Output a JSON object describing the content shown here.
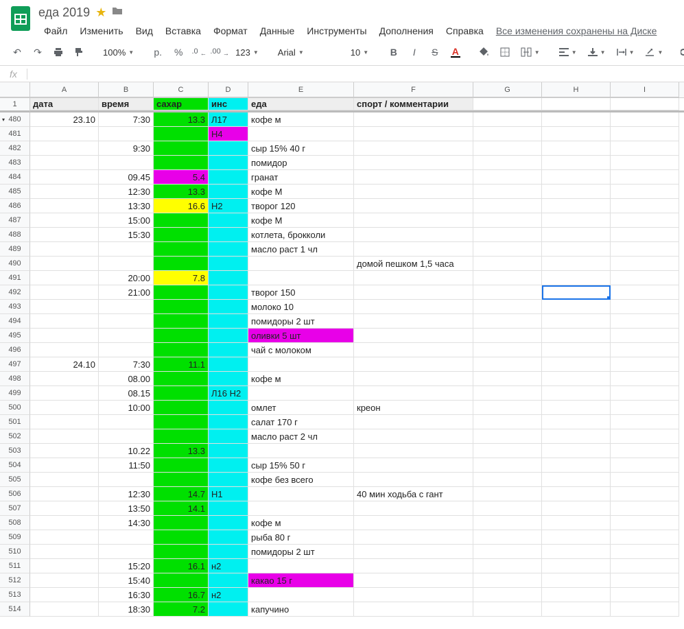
{
  "doc_title": "еда 2019",
  "save_msg": "Все изменения сохранены на Диске",
  "menus": [
    "Файл",
    "Изменить",
    "Вид",
    "Вставка",
    "Формат",
    "Данные",
    "Инструменты",
    "Дополнения",
    "Справка"
  ],
  "toolbar": {
    "zoom": "100%",
    "font": "Arial",
    "size": "10",
    "currency": "р.",
    "percent": "%",
    "dec_dec": ".0",
    "inc_dec": ".00",
    "num_fmt": "123"
  },
  "fx_label": "fx",
  "col_headers": [
    "A",
    "B",
    "C",
    "D",
    "E",
    "F",
    "G",
    "H",
    "I"
  ],
  "frozen_row_label": "1",
  "row_labels": [
    "480",
    "481",
    "482",
    "483",
    "484",
    "485",
    "486",
    "487",
    "488",
    "489",
    "490",
    "491",
    "492",
    "493",
    "494",
    "495",
    "496",
    "497",
    "498",
    "499",
    "500",
    "501",
    "502",
    "503",
    "504",
    "505",
    "506",
    "507",
    "508",
    "509",
    "510",
    "511",
    "512",
    "513",
    "514"
  ],
  "headers": {
    "A": "дата",
    "B": "время",
    "C": "сахар",
    "D": "инс",
    "E": "еда",
    "F": "спорт / комментарии"
  },
  "rows": [
    {
      "A": "23.10",
      "B": "7:30",
      "C": "13.3",
      "Cclass": "green",
      "D": "Л17",
      "Dclass": "cyan",
      "E": "кофе м"
    },
    {
      "Cclass": "green",
      "D": "Н4",
      "Dclass": "magenta"
    },
    {
      "B": "9:30",
      "Cclass": "green",
      "Dclass": "cyan",
      "E": "сыр 15% 40 г"
    },
    {
      "Cclass": "green",
      "Dclass": "cyan",
      "E": "помидор"
    },
    {
      "B": "09.45",
      "C": "5.4",
      "Cclass": "magenta",
      "Dclass": "cyan",
      "E": "гранат"
    },
    {
      "B": "12:30",
      "C": "13.3",
      "Cclass": "green",
      "Dclass": "cyan",
      "E": "кофе М"
    },
    {
      "B": "13:30",
      "C": "16.6",
      "Cclass": "yellow",
      "D": "Н2",
      "Dclass": "cyan",
      "E": "творог 120"
    },
    {
      "B": "15:00",
      "Cclass": "green",
      "Dclass": "cyan",
      "E": "кофе М"
    },
    {
      "B": "15:30",
      "Cclass": "green",
      "Dclass": "cyan",
      "E": "котлета, брокколи"
    },
    {
      "Cclass": "green",
      "Dclass": "cyan",
      "E": "масло раст 1 чл"
    },
    {
      "Cclass": "green",
      "Dclass": "cyan",
      "F": "домой пешком 1,5 часа"
    },
    {
      "B": "20:00",
      "C": "7.8",
      "Cclass": "yellow",
      "Dclass": "cyan"
    },
    {
      "B": "21:00",
      "Cclass": "green",
      "Dclass": "cyan",
      "E": "творог 150"
    },
    {
      "Cclass": "green",
      "Dclass": "cyan",
      "E": "молоко 10"
    },
    {
      "Cclass": "green",
      "Dclass": "cyan",
      "E": "помидоры 2 шт"
    },
    {
      "Cclass": "green",
      "Dclass": "cyan",
      "E": "оливки 5 шт",
      "Eclass": "magenta"
    },
    {
      "Cclass": "green",
      "Dclass": "cyan",
      "E": "чай с молоком"
    },
    {
      "A": "24.10",
      "B": "7:30",
      "C": "11.1",
      "Cclass": "green",
      "Dclass": "cyan"
    },
    {
      "B": "08.00",
      "Cclass": "green",
      "Dclass": "cyan",
      "E": "кофе м"
    },
    {
      "B": "08.15",
      "Cclass": "green",
      "D": "Л16 Н2",
      "Dclass": "cyan"
    },
    {
      "B": "10:00",
      "Cclass": "green",
      "Dclass": "cyan",
      "E": "омлет",
      "F": "креон"
    },
    {
      "Cclass": "green",
      "Dclass": "cyan",
      "E": "салат 170 г"
    },
    {
      "Cclass": "green",
      "Dclass": "cyan",
      "E": "масло раст 2 чл"
    },
    {
      "B": "10.22",
      "C": "13.3",
      "Cclass": "green",
      "Dclass": "cyan"
    },
    {
      "B": "11:50",
      "Cclass": "green",
      "Dclass": "cyan",
      "E": "сыр 15% 50 г"
    },
    {
      "Cclass": "green",
      "Dclass": "cyan",
      "E": "кофе без всего"
    },
    {
      "B": "12:30",
      "C": "14.7",
      "Cclass": "green",
      "D": "Н1",
      "Dclass": "cyan",
      "F": "40 мин ходьба с гант"
    },
    {
      "B": "13:50",
      "C": "14.1",
      "Cclass": "green",
      "Dclass": "cyan"
    },
    {
      "B": "14:30",
      "Cclass": "green",
      "Dclass": "cyan",
      "E": "кофе м"
    },
    {
      "Cclass": "green",
      "Dclass": "cyan",
      "E": "рыба 80 г"
    },
    {
      "Cclass": "green",
      "Dclass": "cyan",
      "E": "помидоры 2 шт"
    },
    {
      "B": "15:20",
      "C": "16.1",
      "Cclass": "green",
      "D": "н2",
      "Dclass": "cyan"
    },
    {
      "B": "15:40",
      "Cclass": "green",
      "Dclass": "cyan",
      "E": "какао 15 г",
      "Eclass": "magenta"
    },
    {
      "B": "16:30",
      "C": "16.7",
      "Cclass": "green",
      "D": "н2",
      "Dclass": "cyan"
    },
    {
      "B": "18:30",
      "C": "7.2",
      "Cclass": "green",
      "Dclass": "cyan",
      "E": "капучино"
    }
  ],
  "selected_cell": {
    "row": 12,
    "col": "H"
  }
}
